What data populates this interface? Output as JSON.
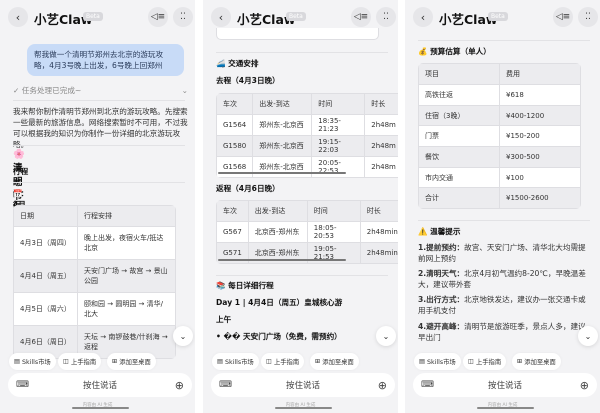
{
  "app": {
    "title": "小艺Claw",
    "badge": "Beta",
    "back_icon": "‹",
    "speaker_icon": "◁≡",
    "grid_icon": "⁚⁚"
  },
  "bottom": {
    "chips": [
      "Skills市场",
      "上手指南",
      "添加至桌面"
    ],
    "input_placeholder": "按住说话",
    "ai_note": "内容由 AI 生成",
    "scroll_icon": "⌄"
  },
  "screen1": {
    "user_message": "帮我做一个清明节郑州去北京的游玩攻略，4月3号晚上出发，6号晚上回郑州",
    "task_status": "✓ 任务处理已完成~",
    "intro": "我来帮你制作清明节郑州到北京的游玩攻略。先搜索一些最新的旅游信息。网络搜索暂时不可用，不过我可以根据我的知识为你制作一份详细的北京游玩攻略。",
    "title": "🌸 清明节郑州→北京游玩攻略",
    "schedule": "行程时间：4月3日晚出发 → 4月6日晚返程",
    "overview_heading": "📅 行程概览",
    "table": {
      "headers": [
        "日期",
        "行程安排"
      ],
      "rows": [
        [
          "4月3日（周四）",
          "晚上出发，夜宿火车/抵达北京"
        ],
        [
          "4月4日（周五）",
          "天安门广场 → 故宫 → 景山公园"
        ],
        [
          "4月5日（周六）",
          "颐和园 → 圆明园 → 清华/北大"
        ],
        [
          "4月6日（周日）",
          "天坛 → 南锣鼓巷/什刹海 → 返程"
        ]
      ]
    }
  },
  "screen2": {
    "transport_heading": "🚄 交通安排",
    "outbound_label": "去程（4月3日晚）",
    "outbound": {
      "headers": [
        "车次",
        "出发-到达",
        "时间",
        "时长"
      ],
      "rows": [
        [
          "G1564",
          "郑州东-北京西",
          "18:35-21:23",
          "2h48m"
        ],
        [
          "G1580",
          "郑州东-北京西",
          "19:15-22:03",
          "2h48m"
        ],
        [
          "G1568",
          "郑州东-北京西",
          "20:05-22:53",
          "2h48m"
        ]
      ]
    },
    "return_label": "返程（4月6日晚）",
    "return": {
      "headers": [
        "车次",
        "出发-到达",
        "时间",
        "时长"
      ],
      "rows": [
        [
          "G567",
          "北京西-郑州东",
          "18:05-20:53",
          "2h48min"
        ],
        [
          "G571",
          "北京西-郑州东",
          "19:05-21:53",
          "2h48min"
        ]
      ]
    },
    "daily_heading": "📚 每日详细行程",
    "day1": "Day 1 | 4月4日（周五）皇城核心游",
    "morning": "上午",
    "item1": "• �� 天安门广场（免费，需预约）"
  },
  "screen3": {
    "budget_heading": "💰 预算估算（单人）",
    "budget": {
      "headers": [
        "项目",
        "费用"
      ],
      "rows": [
        [
          "高铁往返",
          "¥618"
        ],
        [
          "住宿（3晚）",
          "¥400-1200"
        ],
        [
          "门票",
          "¥150-200"
        ],
        [
          "餐饮",
          "¥300-500"
        ],
        [
          "市内交通",
          "¥100"
        ],
        [
          "合计",
          "¥1500-2600"
        ]
      ]
    },
    "tips_heading": "⚠️ 温馨提示",
    "tips": [
      {
        "k": "1.提前预约：",
        "v": "故宫、天安门广场、清华北大均需提前网上预约"
      },
      {
        "k": "2.清明天气：",
        "v": "北京4月初气温约8-20℃，早晚温差大，建议带外套"
      },
      {
        "k": "3.出行方式：",
        "v": "北京地铁发达，建议办一张交通卡或用手机支付"
      },
      {
        "k": "4.避开高峰：",
        "v": "清明节是旅游旺季，景点人多，建议早出门"
      }
    ]
  }
}
